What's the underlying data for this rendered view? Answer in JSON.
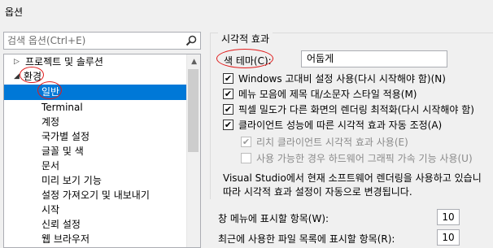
{
  "window": {
    "title": "옵션"
  },
  "search": {
    "placeholder": "검색 옵션(Ctrl+E)"
  },
  "tree": {
    "items": [
      {
        "label": "프로젝트 및 솔루션",
        "arrow": "▷"
      },
      {
        "label": "환경",
        "arrow": "◢"
      },
      {
        "label": "일반"
      },
      {
        "label": "Terminal"
      },
      {
        "label": "계정"
      },
      {
        "label": "국가별 설정"
      },
      {
        "label": "글꼴 및 색"
      },
      {
        "label": "문서"
      },
      {
        "label": "미리 보기 기능"
      },
      {
        "label": "설정 가져오기 및 내보내기"
      },
      {
        "label": "시작"
      },
      {
        "label": "신뢰 설정"
      },
      {
        "label": "웹 브라우저"
      }
    ]
  },
  "visual": {
    "group_title": "시각적 효과",
    "theme_label": "색 테마(C):",
    "theme_value": "어둡게",
    "options": [
      {
        "label": "Windows 고대비 설정 사용(다시 시작해야 함)(N)",
        "checked": true,
        "enabled": true
      },
      {
        "label": "메뉴 모음에 제목 대/소문자 스타일 적용(M)",
        "checked": true,
        "enabled": true
      },
      {
        "label": "픽셀 밀도가 다른 화면의 렌더링 최적화(다시 시작해야 함)",
        "checked": true,
        "enabled": true
      },
      {
        "label": "클라이언트 성능에 따른 시각적 효과 자동 조정(A)",
        "checked": true,
        "enabled": true
      },
      {
        "label": "리치 클라이언트 시각적 효과 사용(E)",
        "checked": true,
        "enabled": false
      },
      {
        "label": "사용 가능한 경우 하드웨어 그래픽 가속 기능 사용(U)",
        "checked": false,
        "enabled": false
      }
    ],
    "info_line1": "Visual Studio에서 현재 소프트웨어 렌더링을 사용하고 있습니",
    "info_line2": "따라 시각적 효과 설정이 자동으로 변경됩니다."
  },
  "window_menu": {
    "label": "창 메뉴에 표시할 항목(W):",
    "value": "10"
  },
  "recent_files": {
    "label": "최근에 사용한 파일 목록에 표시할 항목(R):",
    "value": "10"
  },
  "colors": {
    "selection": "#0078d7",
    "annotation": "#e01b1b"
  }
}
